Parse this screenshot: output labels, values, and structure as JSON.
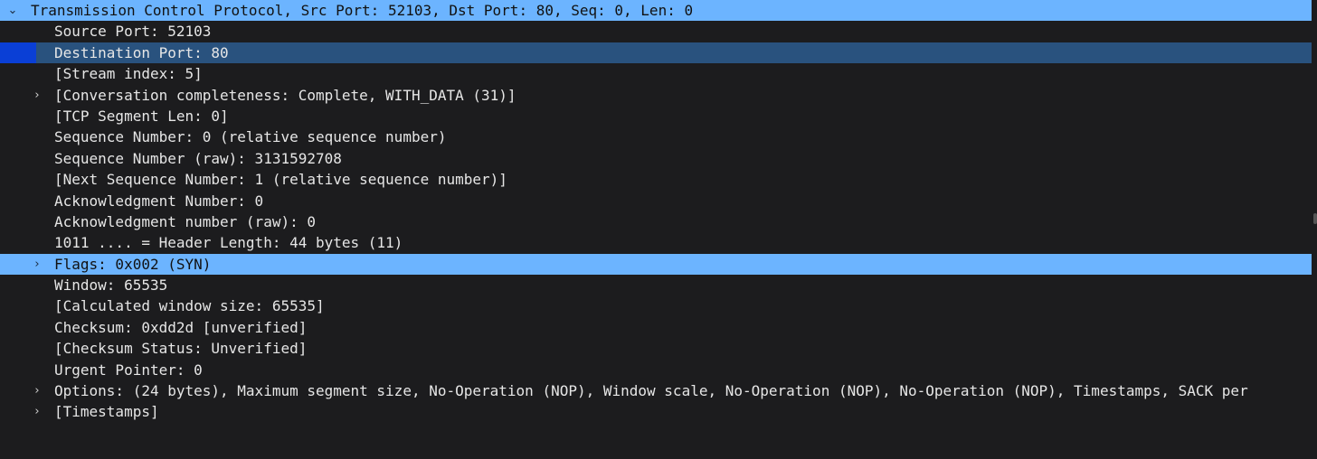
{
  "packet_details": {
    "rows": [
      {
        "label": "Transmission Control Protocol, Src Port: 52103, Dst Port: 80, Seq: 0, Len: 0",
        "level": 0,
        "toggle": "expanded",
        "state": "selected"
      },
      {
        "label": "Source Port: 52103",
        "level": 1,
        "toggle": "none",
        "state": "normal"
      },
      {
        "label": "Destination Port: 80",
        "level": 1,
        "toggle": "none",
        "state": "focused"
      },
      {
        "label": "[Stream index: 5]",
        "level": 1,
        "toggle": "none",
        "state": "normal"
      },
      {
        "label": "[Conversation completeness: Complete, WITH_DATA (31)]",
        "level": 1,
        "toggle": "collapsed",
        "state": "normal"
      },
      {
        "label": "[TCP Segment Len: 0]",
        "level": 1,
        "toggle": "none",
        "state": "normal"
      },
      {
        "label": "Sequence Number: 0    (relative sequence number)",
        "level": 1,
        "toggle": "none",
        "state": "normal"
      },
      {
        "label": "Sequence Number (raw): 3131592708",
        "level": 1,
        "toggle": "none",
        "state": "normal"
      },
      {
        "label": "[Next Sequence Number: 1    (relative sequence number)]",
        "level": 1,
        "toggle": "none",
        "state": "normal"
      },
      {
        "label": "Acknowledgment Number: 0",
        "level": 1,
        "toggle": "none",
        "state": "normal"
      },
      {
        "label": "Acknowledgment number (raw): 0",
        "level": 1,
        "toggle": "none",
        "state": "normal"
      },
      {
        "label": "1011 .... = Header Length: 44 bytes (11)",
        "level": 1,
        "toggle": "none",
        "state": "normal"
      },
      {
        "label": "Flags: 0x002 (SYN)",
        "level": 1,
        "toggle": "collapsed",
        "state": "selected"
      },
      {
        "label": "Window: 65535",
        "level": 1,
        "toggle": "none",
        "state": "normal"
      },
      {
        "label": "[Calculated window size: 65535]",
        "level": 1,
        "toggle": "none",
        "state": "normal"
      },
      {
        "label": "Checksum: 0xdd2d [unverified]",
        "level": 1,
        "toggle": "none",
        "state": "normal"
      },
      {
        "label": "[Checksum Status: Unverified]",
        "level": 1,
        "toggle": "none",
        "state": "normal"
      },
      {
        "label": "Urgent Pointer: 0",
        "level": 1,
        "toggle": "none",
        "state": "normal"
      },
      {
        "label": "Options: (24 bytes), Maximum segment size, No-Operation (NOP), Window scale, No-Operation (NOP), No-Operation (NOP), Timestamps, SACK per",
        "level": 1,
        "toggle": "collapsed",
        "state": "normal"
      },
      {
        "label": "[Timestamps]",
        "level": 1,
        "toggle": "collapsed",
        "state": "normal"
      }
    ],
    "icons": {
      "expanded": "chevron-down-icon",
      "collapsed": "chevron-right-icon"
    },
    "colors": {
      "background": "#1c1c1e",
      "selected_row": "#6cb4ff",
      "focused_row": "#29527e",
      "focus_marker": "#0a3fd6"
    }
  }
}
